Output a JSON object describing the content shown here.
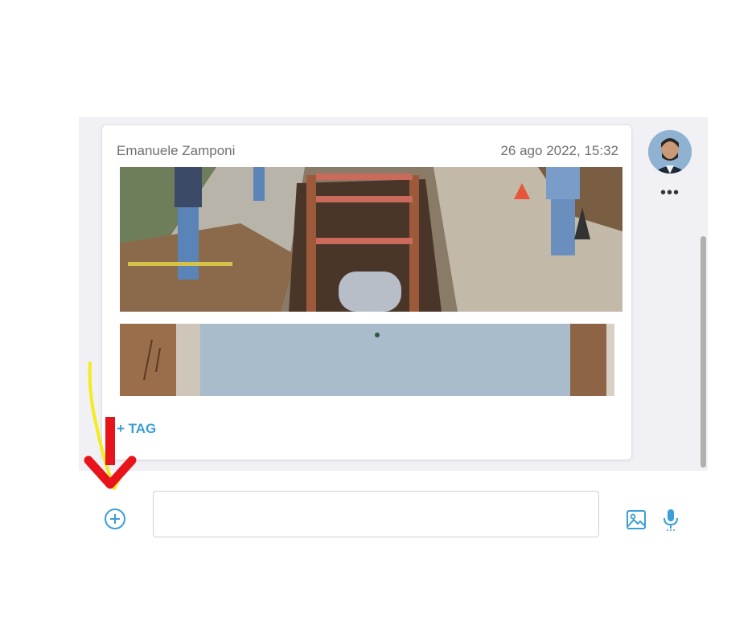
{
  "message": {
    "author": "Emanuele Zamponi",
    "timestamp": "26 ago 2022, 15:32",
    "tag_label": "+ TAG",
    "photos": [
      "excavation-trench-photo",
      "trench-wall-photo"
    ]
  },
  "avatar": {
    "icon": "user-avatar"
  },
  "menu": {
    "icon": "more-options-icon",
    "glyph": "•••"
  },
  "composer": {
    "input_value": "",
    "input_placeholder": "",
    "icons": [
      "plus-circle-icon",
      "image-icon",
      "microphone-icon"
    ]
  },
  "annotations": {
    "arrow_color": "#e8141b",
    "highlight_color": "#f5ec1c"
  },
  "colors": {
    "accent": "#3a9fd6",
    "panel_bg": "#f0f0f5",
    "text_muted": "#707070"
  }
}
